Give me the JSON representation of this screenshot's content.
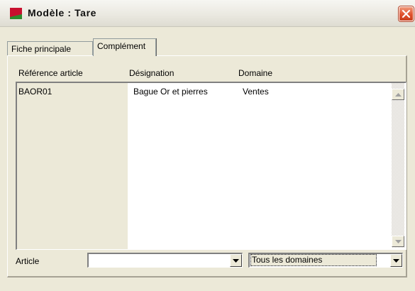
{
  "window": {
    "title": "Modèle : Tare"
  },
  "tabs": [
    {
      "label": "Fiche principale",
      "selected": false
    },
    {
      "label": "Complément",
      "selected": true
    }
  ],
  "table": {
    "columns": [
      "Référence article",
      "Désignation",
      "Domaine"
    ],
    "rows": [
      [
        "BAOR01",
        "Bague Or et pierres",
        "Ventes"
      ]
    ]
  },
  "filters": {
    "article_label": "Article",
    "article_value": "",
    "domain_value": "Tous les domaines"
  },
  "icons": {
    "app": "app-window-icon",
    "close": "close-icon",
    "scroll_up": "scroll-up-arrow-icon",
    "scroll_down": "scroll-down-arrow-icon",
    "dropdown": "dropdown-arrow-icon"
  },
  "colors": {
    "window_bg": "#ECE9D8",
    "close_button": "#E0512D",
    "app_icon_red": "#C8102E",
    "app_icon_green": "#2E8B2E"
  }
}
